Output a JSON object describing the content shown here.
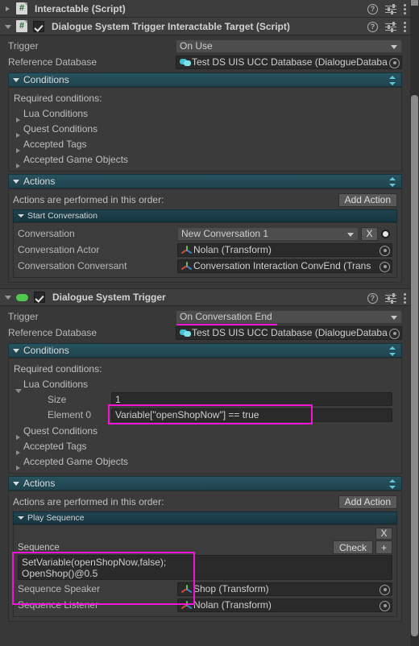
{
  "components": [
    {
      "title": "Interactable (Script)",
      "icon": "csharp-script-icon",
      "expanded": false,
      "enabled": true,
      "header_icons": [
        "help-icon",
        "preset-icon",
        "more-menu-icon"
      ]
    },
    {
      "title": "Dialogue System Trigger Interactable Target (Script)",
      "icon": "csharp-script-icon",
      "expanded": true,
      "enabled": true,
      "trigger": {
        "label": "Trigger",
        "value": "On Use"
      },
      "reference_database": {
        "label": "Reference Database",
        "value": "Test DS UIS UCC Database (DialogueDataba",
        "icon": "dialogue-database-icon"
      },
      "conditions": {
        "header": "Conditions",
        "note": "Required conditions:",
        "items": [
          {
            "label": "Lua Conditions",
            "expanded": false
          },
          {
            "label": "Quest Conditions",
            "expanded": false
          },
          {
            "label": "Accepted Tags",
            "expanded": false
          },
          {
            "label": "Accepted Game Objects",
            "expanded": false
          }
        ]
      },
      "actions": {
        "header": "Actions",
        "note": "Actions are performed in this order:",
        "add_button": "Add Action",
        "action_title": "Start Conversation",
        "fields": [
          {
            "label": "Conversation",
            "value": "New Conversation 1",
            "type": "popup",
            "clear_button": "X"
          },
          {
            "label": "Conversation Actor",
            "value": "Nolan (Transform)",
            "type": "object"
          },
          {
            "label": "Conversation Conversant",
            "value": "Conversation Interaction ConvEnd (Trans",
            "type": "object"
          }
        ]
      }
    },
    {
      "title": "Dialogue System Trigger",
      "icon": "green-pill-icon",
      "expanded": true,
      "enabled": true,
      "trigger": {
        "label": "Trigger",
        "value": "On Conversation End",
        "highlighted": true
      },
      "reference_database": {
        "label": "Reference Database",
        "value": "Test DS UIS UCC Database (DialogueDataba",
        "icon": "dialogue-database-icon"
      },
      "conditions": {
        "header": "Conditions",
        "note": "Required conditions:",
        "lua": {
          "label": "Lua Conditions",
          "expanded": true,
          "size_label": "Size",
          "size_value": "1",
          "element_label": "Element 0",
          "element_value": "Variable[\"openShopNow\"] == true",
          "highlighted": true
        },
        "items": [
          {
            "label": "Quest Conditions",
            "expanded": false
          },
          {
            "label": "Accepted Tags",
            "expanded": false
          },
          {
            "label": "Accepted Game Objects",
            "expanded": false
          }
        ]
      },
      "actions": {
        "header": "Actions",
        "note": "Actions are performed in this order:",
        "add_button": "Add Action",
        "action_title": "Play Sequence",
        "remove_button": "X",
        "check_button": "Check",
        "plus_button": "+",
        "sequence_label": "Sequence",
        "sequence_value_line1": "SetVariable(openShopNow,false);",
        "sequence_value_line2": "OpenShop()@0.5",
        "fields": [
          {
            "label": "Sequence Speaker",
            "value": "Shop (Transform)",
            "type": "object"
          },
          {
            "label": "Sequence Listener",
            "value": "Nolan (Transform)",
            "type": "object"
          }
        ]
      }
    }
  ],
  "colors": {
    "highlight": "#f215d4",
    "section_header": "#27525f",
    "background": "#383838",
    "field": "#2a2a2a"
  }
}
